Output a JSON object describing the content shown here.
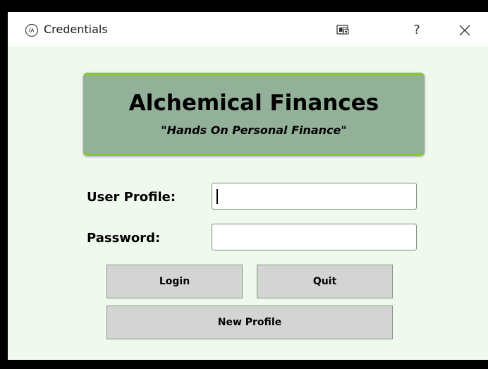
{
  "window": {
    "title": "Credentials",
    "help_label": "?",
    "icons": {
      "app": "app-icon",
      "snap": "snap-layout-icon",
      "close": "close-icon"
    }
  },
  "banner": {
    "title": "Alchemical Finances",
    "subtitle": "\"Hands On Personal Finance\""
  },
  "form": {
    "user_profile_label": "User Profile:",
    "user_profile_value": "",
    "password_label": "Password:",
    "password_value": ""
  },
  "buttons": {
    "login": "Login",
    "quit": "Quit",
    "new_profile": "New Profile"
  },
  "colors": {
    "window_background": "#f0f9ee",
    "banner_background": "#93b098",
    "banner_accent": "#8ac43f",
    "button_background": "#d4d4d4"
  }
}
